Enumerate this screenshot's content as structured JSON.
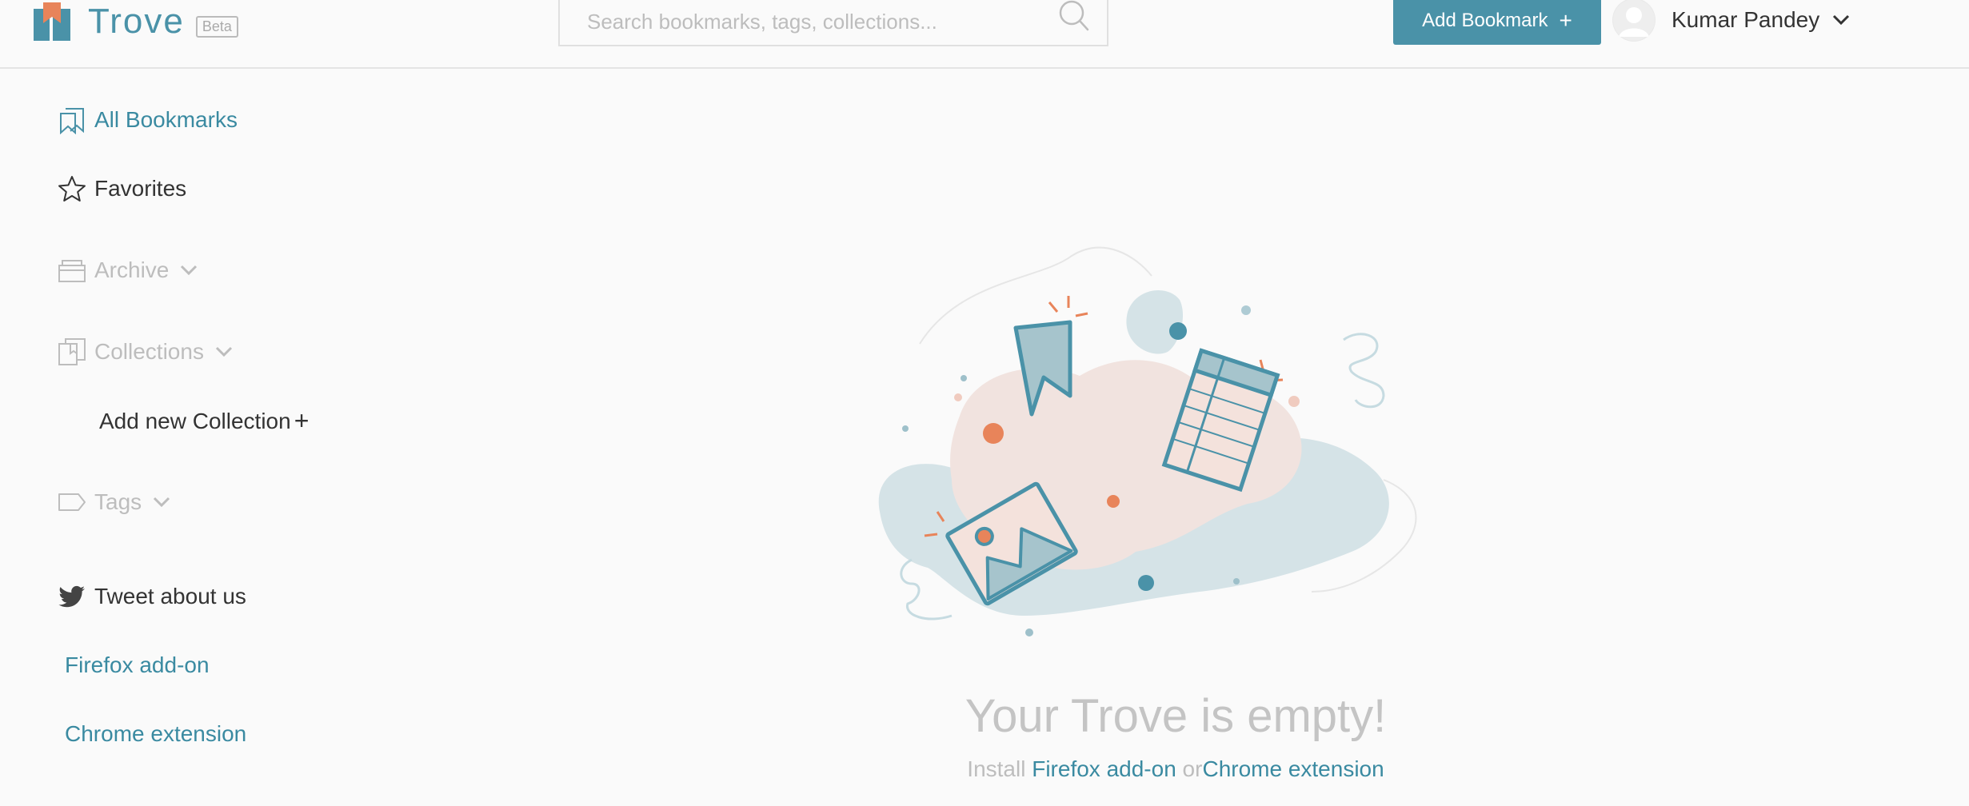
{
  "header": {
    "logo_text": "Trove",
    "beta_badge": "Beta",
    "search_placeholder": "Search bookmarks, tags, collections...",
    "add_bookmark_label": "Add Bookmark",
    "add_bookmark_plus": "+",
    "user_name": "Kumar Pandey"
  },
  "sidebar": {
    "all_bookmarks": "All Bookmarks",
    "favorites": "Favorites",
    "archive": "Archive",
    "collections": "Collections",
    "add_collection": "Add new Collection",
    "add_collection_plus": "+",
    "tags": "Tags",
    "tweet": "Tweet about us",
    "firefox_addon": "Firefox add-on",
    "chrome_extension": "Chrome extension"
  },
  "main": {
    "empty_title": "Your Trove is empty!",
    "install_prefix": "Install ",
    "install_firefox": "Firefox add-on",
    "install_or": " or",
    "install_chrome": "Chrome extension"
  },
  "colors": {
    "accent": "#4a92a8",
    "link": "#3a8aa1",
    "muted": "#bdbdbd",
    "orange": "#e8845a"
  }
}
